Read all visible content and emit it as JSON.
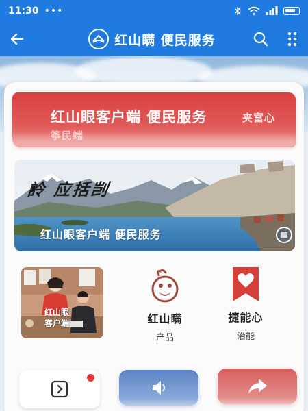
{
  "status_bar": {
    "time": "11:30",
    "dots": "•••",
    "colors": {
      "bar": "#1f7be0"
    }
  },
  "header": {
    "title": "红山瞒 便民服务",
    "icons": [
      "back-arrow-icon",
      "app-logo-icon",
      "search-icon",
      "more-vertical-icon"
    ]
  },
  "banner": {
    "title": "红山眼客户端 便民服务",
    "tag": "夹富心",
    "subtitle": "筝民端",
    "color": "#d9403f"
  },
  "landscape": {
    "calligraphy": "詅 应括剀",
    "caption": "红山眼客户端 便民服务",
    "fab_icon": "menu-icon"
  },
  "features": {
    "photo": {
      "line1": "红山眼",
      "line2": "客户端"
    },
    "product": {
      "title": "红山瞒",
      "subtitle": "产品",
      "icon": "mascot-icon"
    },
    "skill": {
      "title": "捷能心",
      "subtitle": "治能",
      "icon": "heart-bookmark-icon"
    }
  },
  "bottom": [
    {
      "label": "",
      "icon": "chevron-box-icon",
      "badge": true
    },
    {
      "label": "",
      "icon": "speaker-icon"
    },
    {
      "label": "",
      "icon": "share-arrow-icon"
    }
  ]
}
